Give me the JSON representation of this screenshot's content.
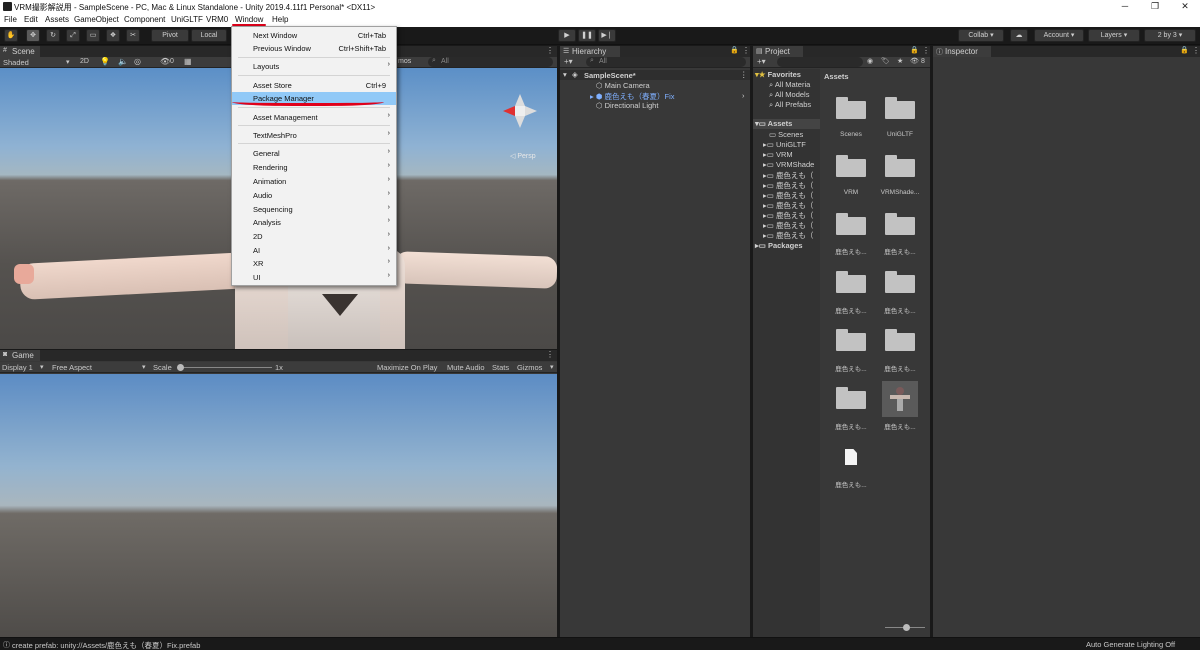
{
  "title_bar": {
    "title": "VRM撮影解説用 - SampleScene - PC, Mac & Linux Standalone - Unity 2019.4.11f1 Personal* <DX11>",
    "minimize": "─",
    "maximize": "❐",
    "close": "✕"
  },
  "menubar": {
    "items": [
      "File",
      "Edit",
      "Assets",
      "GameObject",
      "Component",
      "UniGLTF",
      "VRM0",
      "Window",
      "Help"
    ],
    "active": "Window",
    "highlight_color": "#cc0000"
  },
  "toolbar": {
    "pivot_label": "Pivot",
    "local_label": "Local",
    "play_icon": "play-icon",
    "pause_icon": "pause-icon",
    "step_icon": "step-icon",
    "collab_label": "Collab",
    "account_label": "Account",
    "layers_label": "Layers",
    "layout_label": "2 by 3"
  },
  "window_menu": {
    "items": [
      {
        "label": "Next Window",
        "shortcut": "Ctrl+Tab"
      },
      {
        "label": "Previous Window",
        "shortcut": "Ctrl+Shift+Tab"
      },
      {
        "label": "Layouts",
        "arrow": "›"
      },
      {
        "label": "Asset Store",
        "shortcut": "Ctrl+9"
      },
      {
        "label": "Package Manager",
        "selected": true
      },
      {
        "label": "Asset Management",
        "arrow": "›"
      },
      {
        "label": "TextMeshPro",
        "arrow": "›"
      },
      {
        "label": "General",
        "arrow": "›"
      },
      {
        "label": "Rendering",
        "arrow": "›"
      },
      {
        "label": "Animation",
        "arrow": "›"
      },
      {
        "label": "Audio",
        "arrow": "›"
      },
      {
        "label": "Sequencing",
        "arrow": "›"
      },
      {
        "label": "Analysis",
        "arrow": "›"
      },
      {
        "label": "2D",
        "arrow": "›"
      },
      {
        "label": "AI",
        "arrow": "›"
      },
      {
        "label": "XR",
        "arrow": "›"
      },
      {
        "label": "UI",
        "arrow": "›"
      }
    ]
  },
  "scene": {
    "tab": "Scene",
    "shading": "Shaded",
    "mode_2d": "2D",
    "gizmos": "mos",
    "search_placeholder": "All",
    "layers_count": "0",
    "persp_label": "◁ Persp"
  },
  "game": {
    "tab": "Game",
    "display": "Display 1",
    "aspect": "Free Aspect",
    "scale_label": "Scale",
    "scale_value": "1x",
    "maximize": "Maximize On Play",
    "mute": "Mute Audio",
    "stats": "Stats",
    "gizmos": "Gizmos"
  },
  "hierarchy": {
    "tab": "Hierarchy",
    "search_placeholder": "All",
    "scene_name": "SampleScene*",
    "items": [
      "Main Camera",
      "鹿色えも（春夏）Fix",
      "Directional Light"
    ]
  },
  "project": {
    "tab": "Project",
    "count_badge": "8",
    "favorites_label": "Favorites",
    "favorites": [
      "All Materia",
      "All Models",
      "All Prefabs"
    ],
    "assets_label": "Assets",
    "asset_tree": [
      "Scenes",
      "UniGLTF",
      "VRM",
      "VRMShade",
      "鹿色えも（",
      "鹿色えも（",
      "鹿色えも（",
      "鹿色えも（",
      "鹿色えも（",
      "鹿色えも（",
      "鹿色えも（"
    ],
    "packages_label": "Packages",
    "grid_header": "Assets",
    "grid": [
      "Scenes",
      "UniGLTF",
      "VRM",
      "VRMShade...",
      "鹿色えも...",
      "鹿色えも...",
      "鹿色えも...",
      "鹿色えも...",
      "鹿色えも...",
      "鹿色えも...",
      "鹿色えも...",
      "鹿色えも...",
      "鹿色えも..."
    ]
  },
  "inspector": {
    "tab": "Inspector"
  },
  "status": {
    "message": "create prefab: unity://Assets/鹿色えも（春夏）Fix.prefab",
    "right": "Auto Generate Lighting Off"
  },
  "colors": {
    "menu_selection": "#91c9f7",
    "annotation_red": "#e0001a",
    "hierarchy_prefab": "#7fb0ff"
  }
}
